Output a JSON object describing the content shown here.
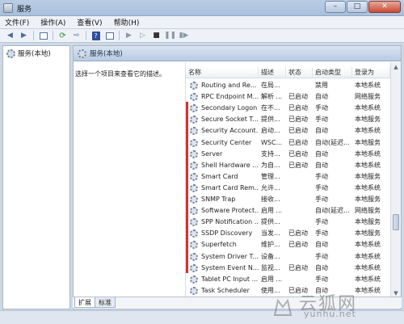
{
  "window": {
    "title": "服务"
  },
  "menu": [
    "文件(F)",
    "操作(A)",
    "查看(V)",
    "帮助(H)"
  ],
  "tree": {
    "item": "服务(本地)"
  },
  "pane": {
    "title": "服务(本地)",
    "description": "选择一个项目来查看它的描述。"
  },
  "columns": [
    "名称",
    "描述",
    "状态",
    "启动类型",
    "登录为"
  ],
  "rows": [
    [
      "Routing and Re...",
      "在局...",
      "",
      "禁用",
      "本地系统"
    ],
    [
      "RPC Endpoint M...",
      "解析 ...",
      "已启动",
      "自动",
      "网络服务"
    ],
    [
      "Secondary Logon",
      "在不...",
      "已启动",
      "手动",
      "本地系统"
    ],
    [
      "Secure Socket T...",
      "提供...",
      "已启动",
      "手动",
      "本地服务"
    ],
    [
      "Security Account...",
      "启动...",
      "已启动",
      "自动",
      "本地系统"
    ],
    [
      "Security Center",
      "WSC...",
      "已启动",
      "自动(延迟...",
      "本地服务"
    ],
    [
      "Server",
      "支持...",
      "已启动",
      "自动",
      "本地系统"
    ],
    [
      "Shell Hardware ...",
      "为自...",
      "已启动",
      "自动",
      "本地系统"
    ],
    [
      "Smart Card",
      "管理...",
      "",
      "手动",
      "本地服务"
    ],
    [
      "Smart Card Rem...",
      "允许...",
      "",
      "手动",
      "本地系统"
    ],
    [
      "SNMP Trap",
      "接收...",
      "",
      "手动",
      "本地服务"
    ],
    [
      "Software Protect...",
      "启用 ...",
      "",
      "自动(延迟...",
      "网络服务"
    ],
    [
      "SPP Notification ...",
      "提供...",
      "",
      "手动",
      "本地服务"
    ],
    [
      "SSDP Discovery",
      "当发...",
      "已启动",
      "手动",
      "本地服务"
    ],
    [
      "Superfetch",
      "维护...",
      "已启动",
      "自动",
      "本地系统"
    ],
    [
      "System Driver T...",
      "设备...",
      "",
      "手动",
      "本地系统"
    ],
    [
      "System Event N...",
      "监视...",
      "已启动",
      "自动",
      "本地系统"
    ],
    [
      "Tablet PC Input ...",
      "启用 ...",
      "",
      "手动",
      "本地系统"
    ],
    [
      "Task Scheduler",
      "使用...",
      "已启动",
      "自动",
      "本地系统"
    ]
  ],
  "tabs": [
    "扩展",
    "标准"
  ],
  "watermark": {
    "title": "云狐网",
    "url": "yunhu.net"
  },
  "colors": {
    "highlight_mark": "#d9302c"
  }
}
